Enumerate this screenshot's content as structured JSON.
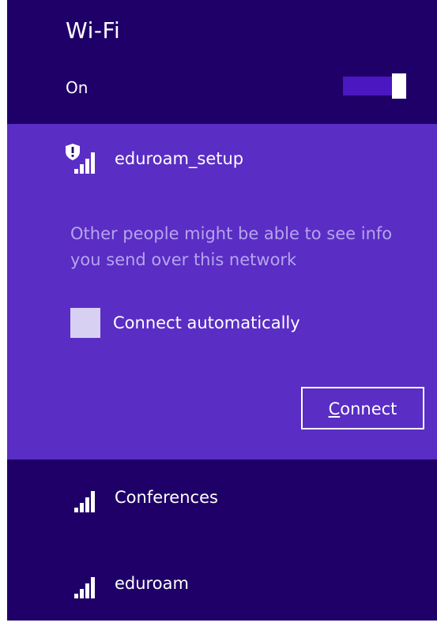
{
  "panel": {
    "title": "Wi-Fi",
    "state_label": "On",
    "toggle_on": true
  },
  "selected_network": {
    "name": "eduroam_setup",
    "security_warning": "Other people might be able to see info you send over this network",
    "auto_connect_label": "Connect automatically",
    "auto_connect_checked": false,
    "connect_button": {
      "mnemonic": "C",
      "rest": "onnect"
    }
  },
  "networks": [
    {
      "name": "Conferences"
    },
    {
      "name": "eduroam"
    }
  ],
  "colors": {
    "panel_bg": "#1f0068",
    "selected_bg": "#5a2dc4",
    "warning_text": "#b7a4ef"
  },
  "icons": {
    "open_network": "unsecured-signal-icon",
    "signal": "signal-strength-icon"
  }
}
